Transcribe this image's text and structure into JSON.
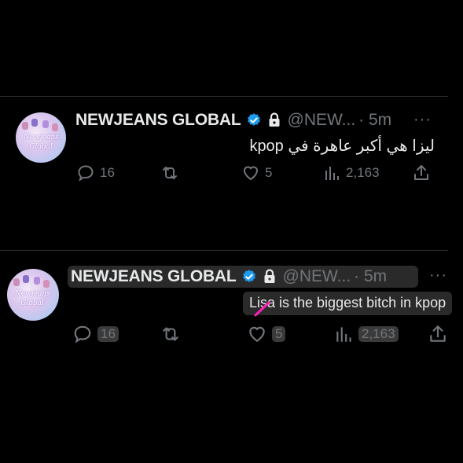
{
  "tweets": [
    {
      "name": "NEWJEANS GLOBAL",
      "handle": "@NEW...",
      "time": "· 5m",
      "more": "···",
      "text": "ليزا هي أكبر عاهرة في kpop",
      "replies": "16",
      "likes": "5",
      "views": "2,163",
      "avatar_text": "Newjeans Global"
    },
    {
      "name": "NEWJEANS GLOBAL",
      "handle": "@NEW...",
      "time": "· 5m",
      "more": "···",
      "text": "Lisa is the biggest bitch in kpop",
      "replies": "16",
      "likes": "5",
      "views": "2,163",
      "avatar_text": "Newjeans Global"
    }
  ],
  "colors": {
    "background": "#000000",
    "text": "#e7e9ea",
    "muted": "#71767b",
    "verified": "#1d9bf0",
    "highlight": "#3a3a3a",
    "pink_mark": "#ff1fb4"
  },
  "icons": [
    "verified-badge-icon",
    "lock-icon",
    "reply-icon",
    "retweet-icon",
    "like-icon",
    "views-icon",
    "share-icon",
    "more-icon"
  ]
}
